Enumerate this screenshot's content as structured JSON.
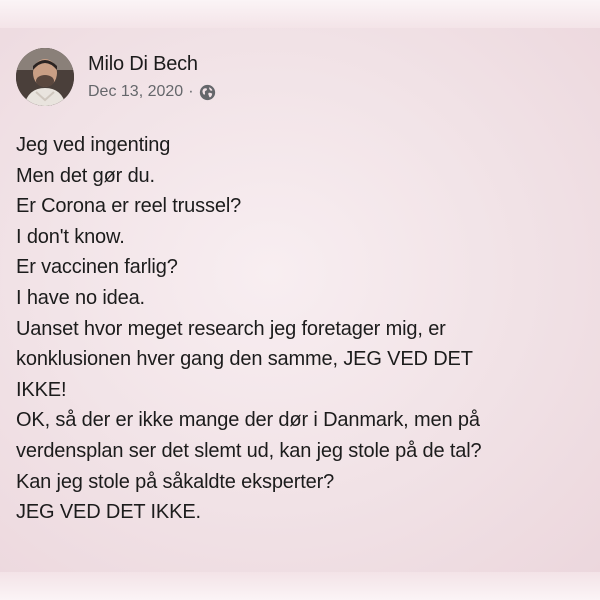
{
  "post": {
    "author": "Milo Di Bech",
    "date": "Dec 13, 2020",
    "separator": "·",
    "privacy_icon": "globe-icon",
    "lines": [
      "Jeg ved ingenting",
      "Men det gør du.",
      "Er Corona er reel trussel?",
      "I don't know.",
      "Er vaccinen farlig?",
      "I have no idea.",
      "Uanset hvor meget research jeg foretager mig, er",
      "konklusionen hver gang den samme, JEG VED DET",
      "IKKE!",
      "OK, så der er ikke mange der dør i Danmark, men på",
      "verdensplan ser det slemt ud, kan jeg stole på de tal?",
      "Kan jeg stole på såkaldte eksperter?",
      "JEG VED DET IKKE."
    ]
  },
  "colors": {
    "background": "#f3e3e7",
    "text": "#1c1c1c",
    "secondary_text": "#65676b"
  }
}
